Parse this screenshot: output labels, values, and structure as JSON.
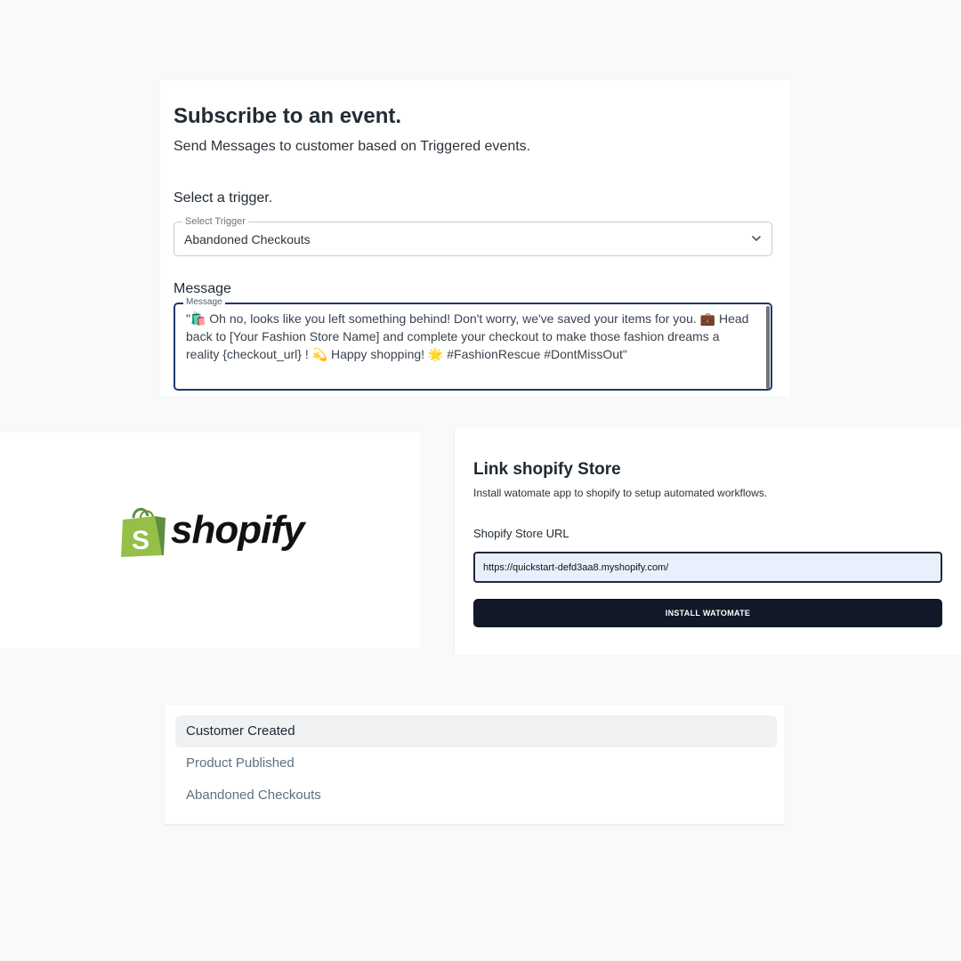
{
  "subscribe": {
    "title": "Subscribe to an event.",
    "subtitle": "Send Messages to customer based on Triggered events.",
    "trigger_label": "Select a trigger.",
    "trigger_legend": "Select Trigger",
    "trigger_value": "Abandoned Checkouts",
    "message_label": "Message",
    "message_legend": "Message",
    "message_text": "\"🛍️ Oh no, looks like you left something behind! Don't worry, we've saved your items for you. 💼 Head back to [Your Fashion Store Name] and complete your checkout to make those fashion dreams a reality {checkout_url} ! 💫 Happy shopping! 🌟 #FashionRescue #DontMissOut\""
  },
  "logo": {
    "word": "shopify",
    "bag_letter": "S",
    "brand_green": "#95bf47",
    "brand_dark": "#5e8e3e"
  },
  "link_store": {
    "title": "Link shopify Store",
    "subtitle": "Install watomate app to shopify to setup automated workflows.",
    "url_label": "Shopify Store URL",
    "url_value": "https://quickstart-defd3aa8.myshopify.com/",
    "button_label": "INSTALL WATOMATE",
    "button_color": "#111827"
  },
  "options": {
    "items": [
      "Customer Created",
      "Product Published",
      "Abandoned Checkouts"
    ],
    "selected_index": 0
  }
}
